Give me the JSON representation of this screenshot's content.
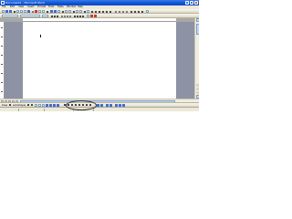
{
  "window": {
    "title": "Document1 - Microsoft Word"
  },
  "title_buttons": [
    "minimize-button",
    "maximize-button",
    "close-button"
  ],
  "menu": {
    "items": [
      "File",
      "Edit",
      "View",
      "Insert",
      "Format",
      "Tools",
      "Table",
      "Window",
      "Help"
    ]
  },
  "toolbar": {
    "style_value": "Normal",
    "font_value": "Times New Roman",
    "size_value": "12"
  },
  "drawing_toolbar": {
    "draw_label": "Draw",
    "autoshapes_label": "AutoShapes"
  },
  "colors": {
    "titlebar": "#0a54d8",
    "chrome": "#ece9d8",
    "workspace": "#8d92a4",
    "page": "#ffffff"
  }
}
